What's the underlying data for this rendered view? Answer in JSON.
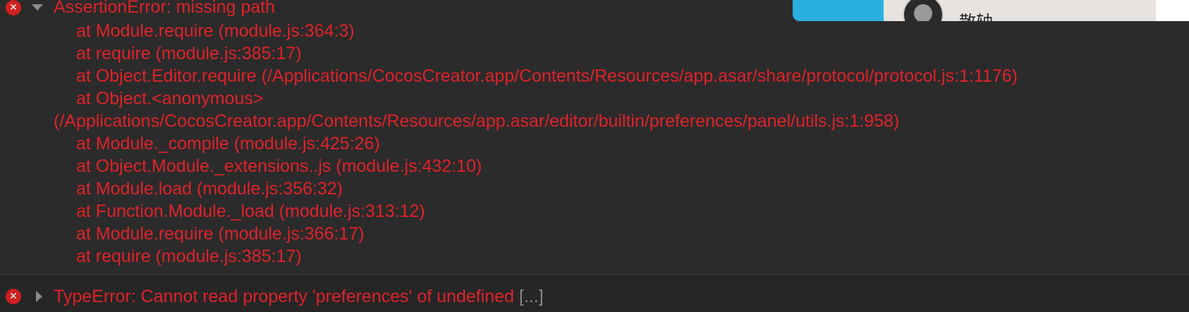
{
  "console": {
    "entries": [
      {
        "level": "error",
        "expanded": true,
        "message": "AssertionError: missing path",
        "stack": [
          "at Module.require (module.js:364:3)",
          "at require (module.js:385:17)",
          "at Object.Editor.require (/Applications/CocosCreator.app/Contents/Resources/app.asar/share/protocol/protocol.js:1:1176)",
          "at Object.<anonymous>",
          "(/Applications/CocosCreator.app/Contents/Resources/app.asar/editor/builtin/preferences/panel/utils.js:1:958)",
          "at Module._compile (module.js:425:26)",
          "at Object.Module._extensions..js (module.js:432:10)",
          "at Module.load (module.js:356:32)",
          "at Function.Module._load (module.js:313:12)",
          "at Module.require (module.js:366:17)",
          "at require (module.js:385:17)"
        ]
      },
      {
        "level": "error",
        "expanded": false,
        "message": "TypeError: Cannot read property 'preferences' of undefined",
        "ellipsis": "[...]"
      }
    ],
    "icons": {
      "error": "error-circle-icon",
      "expand": "triangle-down-icon",
      "collapse": "triangle-right-icon"
    },
    "colors": {
      "background": "#2b2b2b",
      "error_text": "#e0222a",
      "error_icon": "#d01f1f",
      "muted": "#8a8a8a"
    }
  },
  "overlay": {
    "text": "散轴"
  }
}
